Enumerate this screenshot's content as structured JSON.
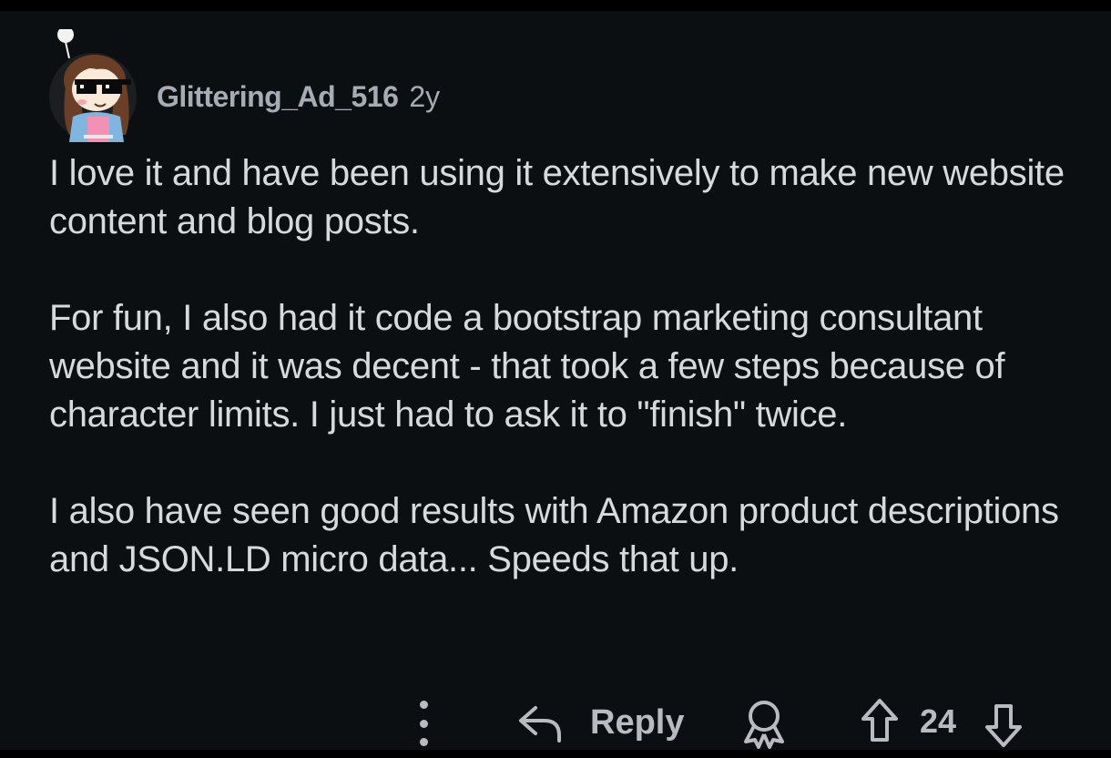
{
  "comment": {
    "author": "Glittering_Ad_516",
    "age": "2y",
    "avatar_icon": "cartoon-avatar-with-pixel-sunglasses-icon",
    "paragraphs": [
      "I love it and have been using it extensively to make new website content and blog posts.",
      "For fun, I also had it code a bootstrap marketing consultant website and it was decent - that took a few steps because of character limits. I just had to ask it to \"finish\" twice.",
      "I also have seen good results with Amazon product descriptions and JSON.LD micro data... Speeds that up."
    ]
  },
  "actions": {
    "more_icon": "vertical-ellipsis-icon",
    "reply_icon": "reply-arrow-icon",
    "reply_label": "Reply",
    "award_icon": "award-icon",
    "upvote_icon": "upvote-arrow-icon",
    "vote_count": "24",
    "downvote_icon": "downvote-arrow-icon"
  },
  "colors": {
    "background": "#0c0f12",
    "body_text": "#d7dadc",
    "meta_text": "#a5acb3",
    "icon": "#b8bcc0"
  }
}
